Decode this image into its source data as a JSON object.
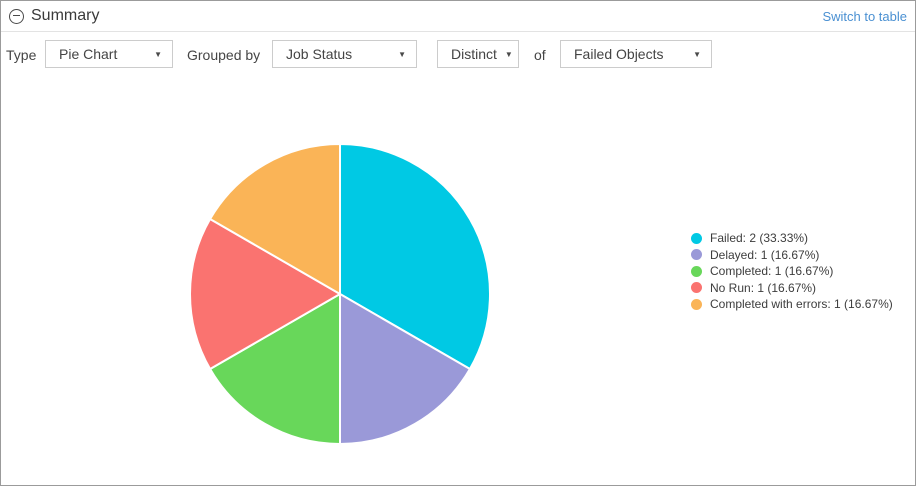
{
  "header": {
    "title": "Summary",
    "switch_to_table": "Switch to table"
  },
  "toolbar": {
    "type_label": "Type",
    "type_select": "Pie Chart",
    "grouped_by_label": "Grouped by",
    "grouped_by_select": "Job Status",
    "aggregate_select": "Distinct",
    "of_label": "of",
    "field_select": "Failed Objects",
    "dropdown_arrow": "▼"
  },
  "chart_data": {
    "type": "pie",
    "categories": [
      "Failed",
      "Delayed",
      "Completed",
      "No Run",
      "Completed with errors"
    ],
    "values": [
      2,
      1,
      1,
      1,
      1
    ],
    "percent_labels": [
      "33.33%",
      "16.67%",
      "16.67%",
      "16.67%",
      "16.67%"
    ],
    "colors": [
      "#00c9e4",
      "#9a99d8",
      "#68d75a",
      "#fa7370",
      "#fab457"
    ],
    "start_angle": "top",
    "direction": "clockwise",
    "legend_position": "right",
    "legend_format": "{category}: {value} ({percent})",
    "slice_stroke_color": "#ffffff"
  },
  "colors": {
    "link": "#4a90d2",
    "panel_border": "#9b9b9b",
    "header_divider": "#e3e3e3",
    "select_border": "#cccccc"
  }
}
